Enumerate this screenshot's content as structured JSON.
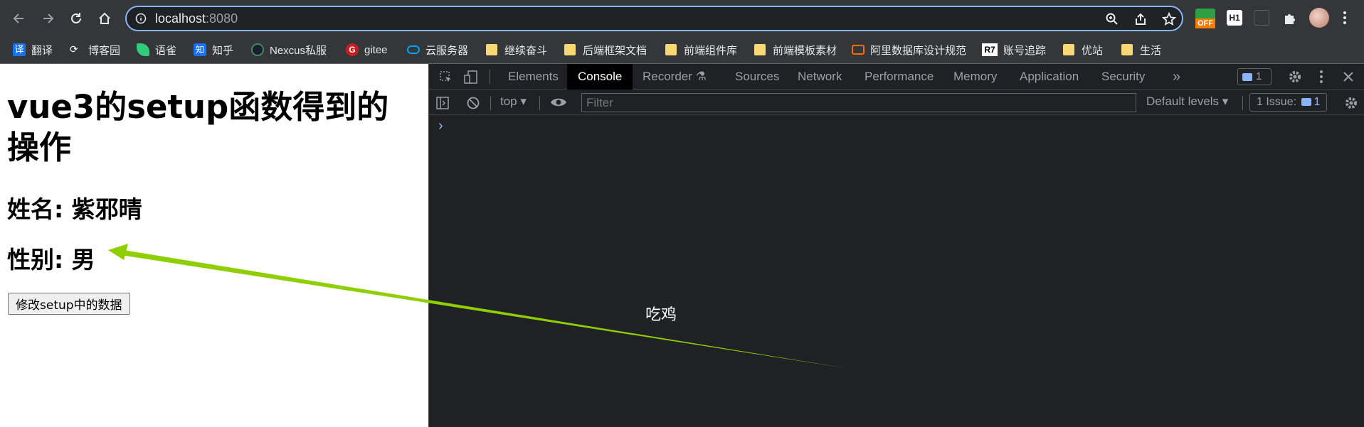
{
  "browser": {
    "url_host": "localhost",
    "url_port": ":8080",
    "bookmarks": [
      {
        "label": "翻译",
        "icon": "translate-icon",
        "color": "#1a73e8"
      },
      {
        "label": "博客园",
        "icon": "cnblogs-icon",
        "color": "#ffffff"
      },
      {
        "label": "语雀",
        "icon": "yuque-icon",
        "color": "#31cc79"
      },
      {
        "label": "知乎",
        "icon": "zhihu-icon",
        "color": "#1772f6"
      },
      {
        "label": "Nexcus私服",
        "icon": "nexus-icon",
        "color": "#1b1c30"
      },
      {
        "label": "gitee",
        "icon": "gitee-icon",
        "color": "#c71d23"
      },
      {
        "label": "云服务器",
        "icon": "cloud-icon",
        "color": "#00a3ff"
      },
      {
        "label": "继续奋斗",
        "icon": "folder-icon",
        "color": "#f8d775"
      },
      {
        "label": "后端框架文档",
        "icon": "folder-icon",
        "color": "#f8d775"
      },
      {
        "label": "前端组件库",
        "icon": "folder-icon",
        "color": "#f8d775"
      },
      {
        "label": "前端模板素材",
        "icon": "folder-icon",
        "color": "#f8d775"
      },
      {
        "label": "阿里数据库设计规范",
        "icon": "aliyun-icon",
        "color": "#ff6a00"
      },
      {
        "label": "账号追踪",
        "icon": "r7-icon",
        "color": "#ffffff"
      },
      {
        "label": "优站",
        "icon": "folder-icon",
        "color": "#f8d775"
      },
      {
        "label": "生活",
        "icon": "folder-icon",
        "color": "#f8d775"
      }
    ],
    "extension_badge": "OFF",
    "extension_h1": "H1"
  },
  "page": {
    "title": "vue3的setup函数得到的操作",
    "name_line": "姓名: 紫邪晴",
    "gender_line": "性别: 男",
    "button_label": "修改setup中的数据"
  },
  "devtools": {
    "tabs": [
      "Elements",
      "Console",
      "Recorder",
      "Sources",
      "Network",
      "Performance",
      "Memory",
      "Application",
      "Security"
    ],
    "active_tab": "Console",
    "more_tabs": "»",
    "issues_badge": "1",
    "context": "top",
    "filter_placeholder": "Filter",
    "levels": "Default levels",
    "issue_label": "1 Issue:",
    "issue_count": "1",
    "prompt": "›"
  },
  "annotation": {
    "caption": "吃鸡",
    "arrow_color": "#8fce00"
  }
}
